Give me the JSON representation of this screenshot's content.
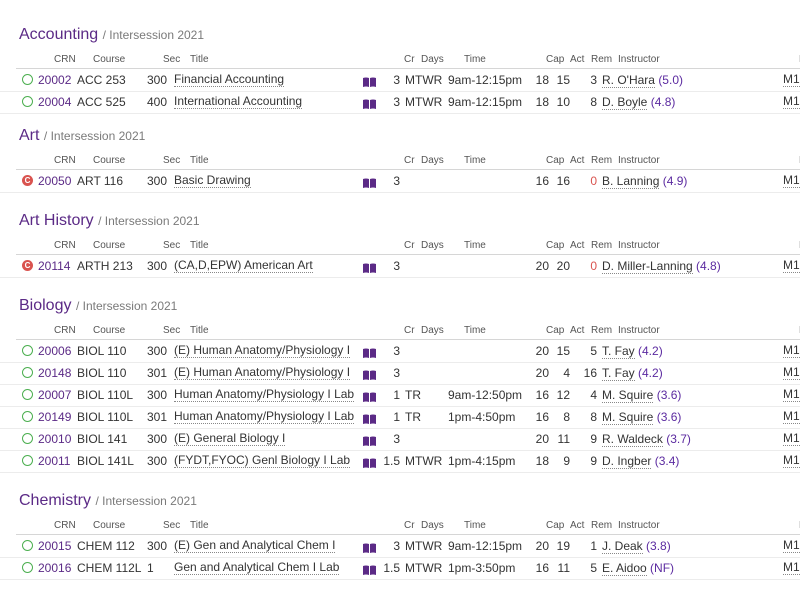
{
  "columns": [
    "CRN",
    "Course",
    "Sec",
    "Title",
    "Cr",
    "Days",
    "Time",
    "Cap",
    "Act",
    "Rem",
    "Instructor",
    "Par"
  ],
  "colors": {
    "accent": "#5b2a86",
    "open": "#4caf50",
    "closed": "#d9534f",
    "rating": "#5b2aa0"
  },
  "sections": [
    {
      "subject": "Accounting",
      "term": "/ Intersession 2021",
      "rows": [
        {
          "status": "open",
          "crn": "20002",
          "course": "ACC 253",
          "sec": "300",
          "title": "Financial Accounting",
          "cr": "3",
          "days": "MTWR",
          "time": "9am-12:15pm",
          "cap": "18",
          "act": "15",
          "rem": "3",
          "instructor": "R. O'Hara",
          "rating": "(5.0)",
          "par": "M1"
        },
        {
          "status": "open",
          "crn": "20004",
          "course": "ACC 525",
          "sec": "400",
          "title": "International Accounting",
          "cr": "3",
          "days": "MTWR",
          "time": "9am-12:15pm",
          "cap": "18",
          "act": "10",
          "rem": "8",
          "instructor": "D. Boyle",
          "rating": "(4.8)",
          "par": "M1"
        }
      ]
    },
    {
      "subject": "Art",
      "term": "/ Intersession 2021",
      "rows": [
        {
          "status": "closed",
          "crn": "20050",
          "course": "ART 116",
          "sec": "300",
          "title": "Basic Drawing",
          "cr": "3",
          "days": "",
          "time": "",
          "cap": "16",
          "act": "16",
          "rem": "0",
          "instructor": "B. Lanning",
          "rating": "(4.9)",
          "par": "M1"
        }
      ]
    },
    {
      "subject": "Art History",
      "term": "/ Intersession 2021",
      "rows": [
        {
          "status": "closed",
          "crn": "20114",
          "course": "ARTH 213",
          "sec": "300",
          "title": "(CA,D,EPW) American Art",
          "cr": "3",
          "days": "",
          "time": "",
          "cap": "20",
          "act": "20",
          "rem": "0",
          "instructor": "D. Miller-Lanning",
          "rating": "(4.8)",
          "par": "M1"
        }
      ]
    },
    {
      "subject": "Biology",
      "term": "/ Intersession 2021",
      "rows": [
        {
          "status": "open",
          "crn": "20006",
          "course": "BIOL 110",
          "sec": "300",
          "title": "(E) Human Anatomy/Physiology I",
          "cr": "3",
          "days": "",
          "time": "",
          "cap": "20",
          "act": "15",
          "rem": "5",
          "instructor": "T. Fay",
          "rating": "(4.2)",
          "par": "M1"
        },
        {
          "status": "open",
          "crn": "20148",
          "course": "BIOL 110",
          "sec": "301",
          "title": "(E) Human Anatomy/Physiology I",
          "cr": "3",
          "days": "",
          "time": "",
          "cap": "20",
          "act": "4",
          "rem": "16",
          "instructor": "T. Fay",
          "rating": "(4.2)",
          "par": "M1"
        },
        {
          "status": "open",
          "crn": "20007",
          "course": "BIOL 110L",
          "sec": "300",
          "title": "Human Anatomy/Physiology I Lab",
          "cr": "1",
          "days": "TR",
          "time": "9am-12:50pm",
          "cap": "16",
          "act": "12",
          "rem": "4",
          "instructor": "M. Squire",
          "rating": "(3.6)",
          "par": "M1"
        },
        {
          "status": "open",
          "crn": "20149",
          "course": "BIOL 110L",
          "sec": "301",
          "title": "Human Anatomy/Physiology I Lab",
          "cr": "1",
          "days": "TR",
          "time": "1pm-4:50pm",
          "cap": "16",
          "act": "8",
          "rem": "8",
          "instructor": "M. Squire",
          "rating": "(3.6)",
          "par": "M1"
        },
        {
          "status": "open",
          "crn": "20010",
          "course": "BIOL 141",
          "sec": "300",
          "title": "(E) General Biology I",
          "cr": "3",
          "days": "",
          "time": "",
          "cap": "20",
          "act": "11",
          "rem": "9",
          "instructor": "R. Waldeck",
          "rating": "(3.7)",
          "par": "M1"
        },
        {
          "status": "open",
          "crn": "20011",
          "course": "BIOL 141L",
          "sec": "300",
          "title": "(FYDT,FYOC) Genl Biology I Lab",
          "cr": "1.5",
          "days": "MTWR",
          "time": "1pm-4:15pm",
          "cap": "18",
          "act": "9",
          "rem": "9",
          "instructor": "D. Ingber",
          "rating": "(3.4)",
          "par": "M1"
        }
      ]
    },
    {
      "subject": "Chemistry",
      "term": "/ Intersession 2021",
      "rows": [
        {
          "status": "open",
          "crn": "20015",
          "course": "CHEM 112",
          "sec": "300",
          "title": "(E) Gen and Analytical Chem I",
          "cr": "3",
          "days": "MTWR",
          "time": "9am-12:15pm",
          "cap": "20",
          "act": "19",
          "rem": "1",
          "instructor": "J. Deak",
          "rating": "(3.8)",
          "par": "M1"
        },
        {
          "status": "open",
          "crn": "20016",
          "course": "CHEM 112L",
          "sec": "1",
          "title": "Gen and Analytical Chem I Lab",
          "cr": "1.5",
          "days": "MTWR",
          "time": "1pm-3:50pm",
          "cap": "16",
          "act": "11",
          "rem": "5",
          "instructor": "E. Aidoo",
          "rating": "(NF)",
          "par": "M1"
        }
      ]
    }
  ]
}
